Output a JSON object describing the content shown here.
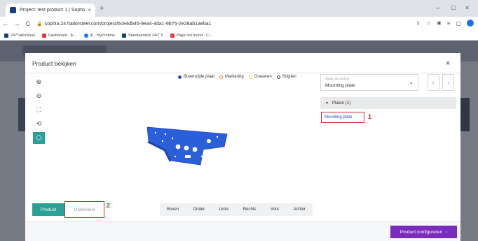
{
  "browser": {
    "tab_title": "Project: test product 1 | Sophia -",
    "tab_close": "×",
    "new_tab": "+",
    "url": "sophia.247tailorsteel.com/project/6ce4db45-9ea4-4da1-9b76-2e28ab1aeba1",
    "window_controls": [
      "–",
      "□",
      "×"
    ],
    "nav": {
      "back": "←",
      "forward": "→",
      "reload": "C"
    },
    "bookmarks": [
      {
        "label": "247TailorSteel",
        "color": "#1a3d7c"
      },
      {
        "label": "Dashboard - Ik...",
        "color": "#e23c3c"
      },
      {
        "label": "Ik - myProtime",
        "color": "#1a73e8"
      },
      {
        "label": "Standaardize 24/7 S",
        "color": "#1a3d7c"
      },
      {
        "label": "Page not found - C...",
        "color": "#e23c3c"
      }
    ]
  },
  "modal": {
    "title": "Product bekijken",
    "close": "×",
    "legend": [
      {
        "label": "Bovenzijde plaat",
        "color": "#2b4bd1",
        "filled": true
      },
      {
        "label": "Markering",
        "color": "#f08c2c",
        "filled": false
      },
      {
        "label": "Graveren",
        "color": "#f2c94c",
        "filled": false
      },
      {
        "label": "Snijden",
        "color": "#333333",
        "filled": false
      }
    ],
    "tools": [
      {
        "name": "zoom-in-icon",
        "glyph": "⊕"
      },
      {
        "name": "zoom-out-icon",
        "glyph": "⊖"
      },
      {
        "name": "fit-screen-icon",
        "glyph": "⛶"
      },
      {
        "name": "rotate-icon",
        "glyph": "⟲"
      },
      {
        "name": "box-view-icon",
        "glyph": "⬡"
      }
    ],
    "select": {
      "placeholder": "Maak uw product",
      "value": "Mounting plate",
      "arrow": "⌄"
    },
    "prev_arrow": "‹",
    "next_arrow": "›",
    "platen_header": "Platen (1)",
    "platen_caret": "▼",
    "platen_item": "Mounting plate",
    "annotation_1": "1",
    "annotation_2": "2",
    "product_tab": "Product",
    "onderdeel_tab": "Onderdeel",
    "views": [
      "Boven",
      "Onder",
      "Links",
      "Rechts",
      "Voor",
      "Achter"
    ],
    "configure_button": "Product configureren",
    "configure_arrow": "›"
  },
  "colors": {
    "accent_teal": "#2aa198",
    "accent_purple": "#7b2cbf",
    "plate_blue": "#2b5fd9",
    "annotation_red": "#e0202a"
  }
}
